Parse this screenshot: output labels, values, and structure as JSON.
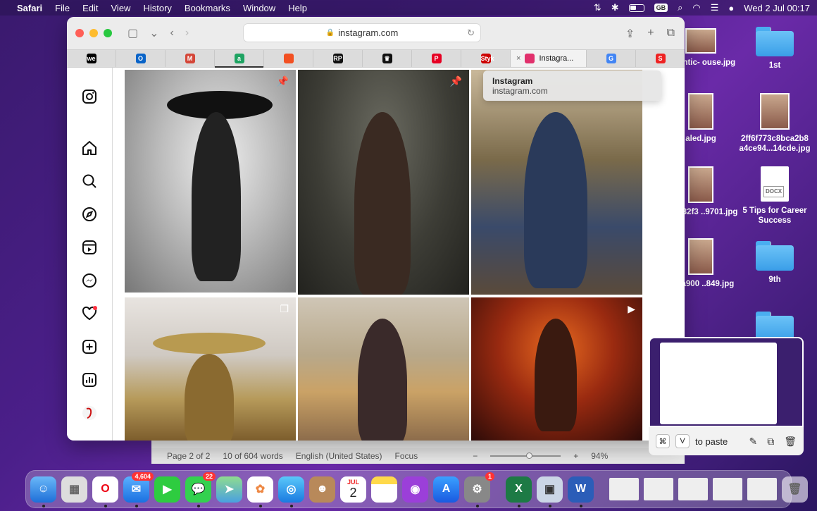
{
  "menubar": {
    "app": "Safari",
    "items": [
      "File",
      "Edit",
      "View",
      "History",
      "Bookmarks",
      "Window",
      "Help"
    ],
    "kbd_badge": "GB",
    "clock": "Wed 2 Jul  00:17"
  },
  "desktop": {
    "items": [
      {
        "label": "1st"
      },
      {
        "label": "2ff6f773c8bca2b8 a4ce94...14cde.jpg"
      },
      {
        "label": "5 Tips for Career Success"
      },
      {
        "label": "9th"
      },
      {
        "label": "-atlantic- ouse.jpg"
      },
      {
        "label": "aled.jpg"
      },
      {
        "label": "16b032f3 ..9701.jpg"
      },
      {
        "label": "8dca900 ..849.jpg"
      }
    ],
    "docx_badge": "DOCX"
  },
  "safari": {
    "address": "instagram.com",
    "tabs": [
      {
        "label": "we",
        "color": "#000"
      },
      {
        "label": "O",
        "color": "#0a64c8"
      },
      {
        "label": "M",
        "color": "#d44638"
      },
      {
        "label": "a",
        "color": "#1ea362"
      },
      {
        "label": "",
        "color": "#f25022"
      },
      {
        "label": "RP",
        "color": "#111"
      },
      {
        "label": "♛",
        "color": "#111"
      },
      {
        "label": "P",
        "color": "#e60023"
      },
      {
        "label": "Styk",
        "color": "#c00"
      },
      {
        "label": "Instagra...",
        "color": "#e1306c"
      },
      {
        "label": "G",
        "color": "#4285f4"
      },
      {
        "label": "S",
        "color": "#e22"
      }
    ],
    "tooltip": {
      "title": "Instagram",
      "url": "instagram.com"
    }
  },
  "word_status": {
    "page": "Page 2 of 2",
    "words": "10 of 604 words",
    "language": "English (United States)",
    "focus": "Focus",
    "zoom": "94%",
    "zoom_level": 0.55
  },
  "preview": {
    "paste_text": "to paste",
    "key1": "⌘",
    "key2": "V"
  },
  "dock": {
    "mail_badge": "4,604",
    "messages_badge": "22",
    "settings_badge": "1",
    "calendar_month": "JUL",
    "calendar_day": "2"
  }
}
